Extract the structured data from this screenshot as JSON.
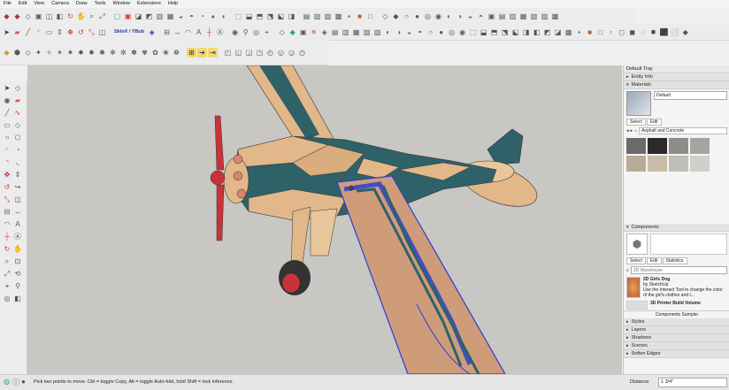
{
  "menu": [
    "File",
    "Edit",
    "View",
    "Camera",
    "Draw",
    "Tools",
    "Window",
    "Extensions",
    "Help"
  ],
  "toolbar": {
    "plugin_label": "SkinX / YBub"
  },
  "tray": {
    "title": "Default Tray",
    "entity_info": "Entity Info",
    "materials": "Materials",
    "material_name": "Default",
    "tab_select": "Select",
    "tab_edit": "Edit",
    "material_category": "Asphalt and Concrete",
    "components": "Components",
    "comp_tab_select": "Select",
    "comp_tab_edit": "Edit",
    "comp_tab_statistics": "Statistics",
    "search_placeholder": "3D Warehouse",
    "item1_title": "2D Girls Dog",
    "item1_by": "by SketchUp",
    "item1_desc": "Use the Interact Tool to change the color of the girl's clothes and t...",
    "item2_title": "3D Printer Build Volume",
    "sampler": "Components Sampler",
    "styles": "Styles",
    "layers": "Layers",
    "shadows": "Shadows",
    "scenes": "Scenes",
    "soften": "Soften Edges"
  },
  "status": {
    "message": "Pick two points to move.  Ctrl = toggle Copy, Alt = toggle Auto-fold, hold Shift = lock inference.",
    "distance_label": "Distance",
    "distance_value": "1 3/4\""
  },
  "colors": {
    "viewport_bg": "#c9c7c3",
    "wood": "#e2b88a",
    "teal": "#2f6168",
    "propeller": "#c8333a",
    "selection": "#2a3fd0"
  }
}
